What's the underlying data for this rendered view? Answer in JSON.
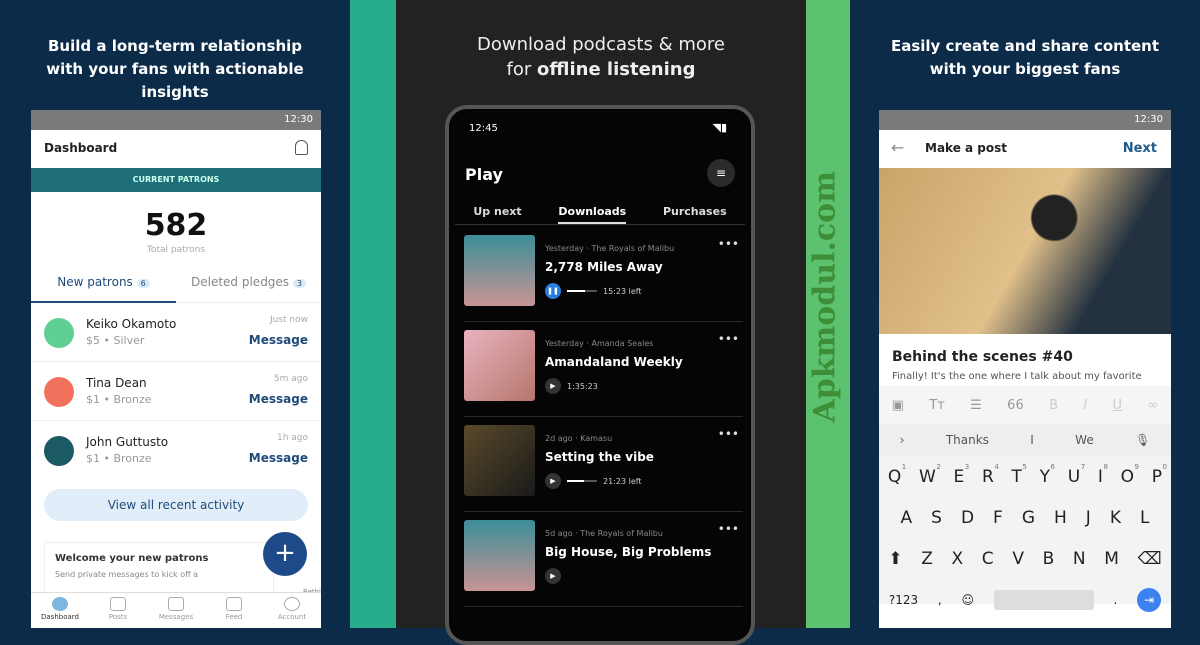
{
  "left": {
    "caption": "Build a long-term relationship with your fans with actionable insights",
    "status_time": "12:30",
    "title": "Dashboard",
    "banner": "CURRENT PATRONS",
    "total": "582",
    "total_label": "Total patrons",
    "tabs": [
      {
        "label": "New patrons",
        "count": "6"
      },
      {
        "label": "Deleted pledges",
        "count": "3"
      }
    ],
    "patrons": [
      {
        "name": "Keiko Okamoto",
        "tier": "$5 • Silver",
        "time": "Just now",
        "action": "Message",
        "color": "#5fcf94"
      },
      {
        "name": "Tina Dean",
        "tier": "$1 • Bronze",
        "time": "5m ago",
        "action": "Message",
        "color": "#f2715c"
      },
      {
        "name": "John Guttusto",
        "tier": "$1 • Bronze",
        "time": "1h ago",
        "action": "Message",
        "color": "#1b5a63"
      }
    ],
    "view_all": "View all recent activity",
    "welcome_title": "Welcome your new patrons",
    "welcome_text": "Send private messages to kick off a",
    "side_text": "Rethi",
    "nav": [
      "Dashboard",
      "Posts",
      "Messages",
      "Feed",
      "Account"
    ]
  },
  "center": {
    "caption_line1": "Download podcasts & more",
    "caption_pre": "for ",
    "caption_bold": "offline listening",
    "status_time": "12:45",
    "title": "Play",
    "tabs": [
      "Up next",
      "Downloads",
      "Purchases"
    ],
    "active_tab": "Downloads",
    "episodes": [
      {
        "meta": "Yesterday · The Royals of Malibu",
        "title": "2,778 Miles Away",
        "time": "15:23 left",
        "progress": 0.6,
        "playing": true
      },
      {
        "meta": "Yesterday · Amanda Seales",
        "title": "Amandaland Weekly",
        "time": "1:35:23"
      },
      {
        "meta": "2d ago · Kamasu",
        "title": "Setting the vibe",
        "time": "21:23 left",
        "progress": 0.55
      },
      {
        "meta": "5d ago · The Royals of Malibu",
        "title": "Big House, Big Problems",
        "time": ""
      }
    ]
  },
  "right": {
    "caption": "Easily create and share content with your biggest fans",
    "status_time": "12:30",
    "title": "Make a post",
    "next": "Next",
    "post_title": "Behind the scenes #40",
    "post_text": "Finally! It's the one where I talk about my favorite",
    "suggestions": [
      "Thanks",
      "I",
      "We"
    ],
    "rows": [
      [
        "Q",
        "W",
        "E",
        "R",
        "T",
        "Y",
        "U",
        "I",
        "O",
        "P"
      ],
      [
        "A",
        "S",
        "D",
        "F",
        "G",
        "H",
        "J",
        "K",
        "L"
      ],
      [
        "Z",
        "X",
        "C",
        "V",
        "B",
        "N",
        "M"
      ]
    ],
    "nums": [
      "1",
      "2",
      "3",
      "4",
      "5",
      "6",
      "7",
      "8",
      "9",
      "0"
    ],
    "sym": "?123"
  },
  "watermark": "Apkmodul.com",
  "colors": {
    "navy": "#0c2b49",
    "teal": "#27ad8c",
    "green": "#5cc26f",
    "accent": "#1f4a7a"
  }
}
